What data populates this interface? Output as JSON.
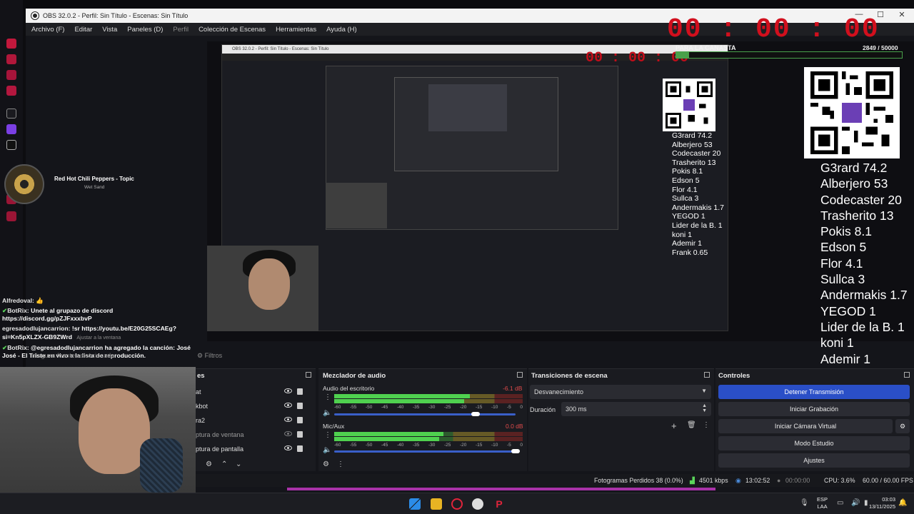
{
  "window": {
    "title": "OBS 32.0.2 - Perfil: Sin Título - Escenas: Sin Título",
    "minimize": "—",
    "maximize": "☐",
    "close": "✕"
  },
  "menu": {
    "items": [
      "Archivo (F)",
      "Editar",
      "Vista",
      "Paneles (D)",
      "Perfil",
      "Colección de Escenas",
      "Herramientas",
      "Ayuda (H)"
    ]
  },
  "overlay": {
    "timer": "00 : 00 : 00",
    "goal_label": "PARA LA CANASTA",
    "goal_value": "2849 / 50000",
    "goal_progress": 0.057,
    "leaderboard": [
      "G3rard 74.2",
      "Alberjero 53",
      "Codecaster 20",
      "Trasherito 13",
      "Pokis 8.1",
      "Edson 5",
      "Flor 4.1",
      "Sullca 3",
      "Andermakis 1.7",
      "YEGOD 1",
      "Lider de la B. 1",
      "koni 1",
      "Ademir 1",
      "Frank 0.65"
    ],
    "music_title": "Red Hot Chili Peppers - Topic",
    "music_subtitle": "Wet Sand"
  },
  "chat": [
    {
      "user": "Alfredoval:",
      "text": "👍",
      "icon": "none"
    },
    {
      "user": "BotRix:",
      "text": "Unete al grupazo de discord https://discord.gg/pZJFxxxbvP",
      "icon": "sword-icon"
    },
    {
      "user": "egresadodlujancarrion:",
      "text": "!sr https://youtu.be/E20G25SCAEg?si=Kn5pXLZX-GB9ZWrd",
      "icon": "none",
      "hint": "Ajustar a la ventana"
    },
    {
      "user": "BotRix:",
      "text": "@egresadodlujancarrion ha agregado la canción: José José - El Triste en vivo a la lista de reproducción.",
      "icon": "sword-icon"
    }
  ],
  "tabs": {
    "properties_ghost": "Ninguna fuente seleccionada",
    "filters": "Filtros"
  },
  "sources": {
    "title": "es",
    "items": [
      {
        "label": "at",
        "visible": true
      },
      {
        "label": "kbot",
        "visible": true
      },
      {
        "label": "ra2",
        "visible": true
      },
      {
        "label": "ptura de ventana",
        "visible": false
      },
      {
        "label": "ptura de pantalla",
        "visible": true
      }
    ]
  },
  "mixer": {
    "title": "Mezclador de audio",
    "scale": [
      "-60",
      "-55",
      "-50",
      "-45",
      "-40",
      "-35",
      "-30",
      "-25",
      "-20",
      "-15",
      "-10",
      "-5",
      "0"
    ],
    "channels": [
      {
        "name": "Audio del escritorio",
        "db": "-6.1 dB",
        "level": 0.72,
        "volume": 0.78
      },
      {
        "name": "Mic/Aux",
        "db": "0.0 dB",
        "level": 0.58,
        "volume": 1.0
      }
    ]
  },
  "transitions": {
    "title": "Transiciones de escena",
    "selected": "Desvanecimiento",
    "duration_label": "Duración",
    "duration_value": "300 ms"
  },
  "controls": {
    "title": "Controles",
    "buttons": [
      "Detener Transmisión",
      "Iniciar Grabación",
      "Iniciar Cámara Virtual",
      "Modo Estudio",
      "Ajustes"
    ]
  },
  "status": {
    "dropped": "Fotogramas Perdidos 38 (0.0%)",
    "bitrate": "4501 kbps",
    "live_time": "13:02:52",
    "rec_time": "00:00:00",
    "cpu": "CPU: 3.6%",
    "fps": "60.00 / 60.00 FPS"
  },
  "taskbar": {
    "lang_1": "ESP",
    "lang_2": "LAA",
    "time": "03:03",
    "date": "13/11/2025"
  },
  "colors": {
    "accent": "#2a4fc7",
    "timer": "#d10f1d",
    "goal": "#49a14b"
  }
}
